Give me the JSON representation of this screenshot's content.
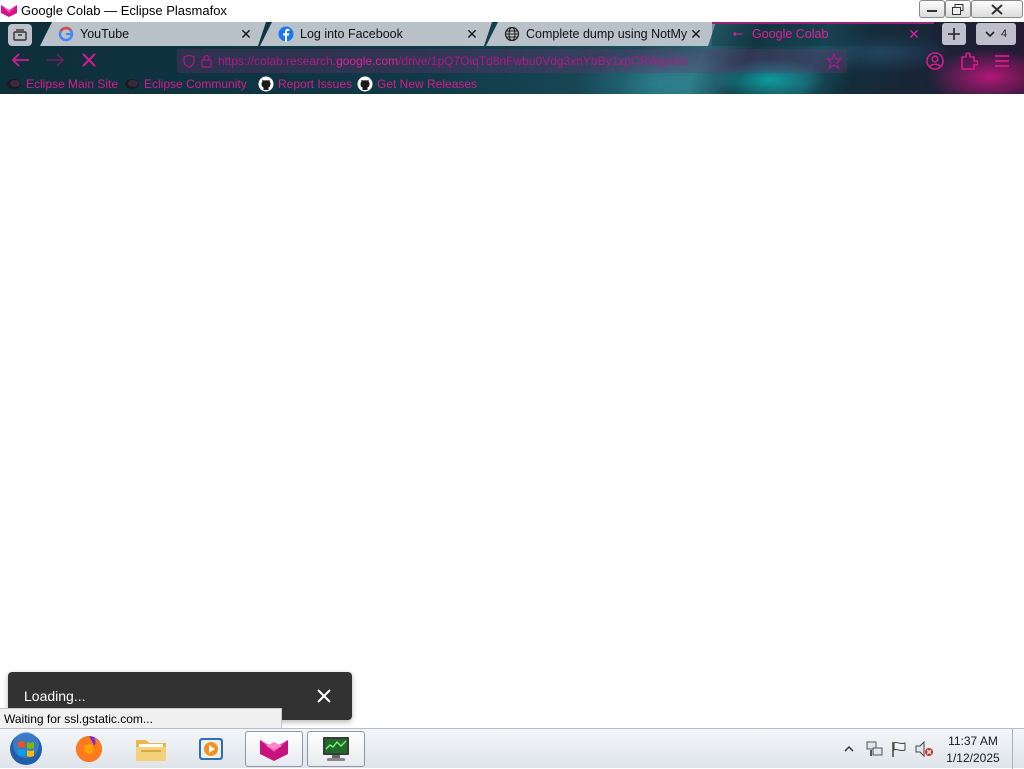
{
  "window": {
    "title": "Google Colab — Eclipse Plasmafox"
  },
  "tabs": [
    {
      "label": "YouTube",
      "icon": "google-icon"
    },
    {
      "label": "Log into Facebook",
      "icon": "facebook-icon"
    },
    {
      "label": "Complete dump using NotMyF",
      "icon": "globe-icon"
    },
    {
      "label": "Google Colab",
      "icon": "loading-icon",
      "active": true
    }
  ],
  "tab_count": "4",
  "url": {
    "prefix": "https://colab.research.",
    "host": "google.com",
    "path": "/drive/1pQ7OiqTd8nFwbu0Vdg3xnYbBy1xpCRWgcGo",
    "placeholder": ""
  },
  "bookmarks": [
    {
      "label": "Eclipse Main Site",
      "icon": "eclipse-icon"
    },
    {
      "label": "Eclipse Community",
      "icon": "eclipse-icon"
    },
    {
      "label": "Report Issues",
      "icon": "github-icon"
    },
    {
      "label": "Get New Releases",
      "icon": "github-icon"
    }
  ],
  "toast": {
    "text": "Loading..."
  },
  "status": {
    "text": "Waiting for ssl.gstatic.com..."
  },
  "taskbar": {
    "time": "11:37 AM",
    "date": "1/12/2025",
    "apps": [
      "firefox",
      "file-explorer",
      "media-player",
      "plasmafox",
      "system-monitor"
    ]
  },
  "colors": {
    "accent": "#e0209a",
    "toast_bg": "#323232",
    "chrome_bg": "#103847"
  }
}
